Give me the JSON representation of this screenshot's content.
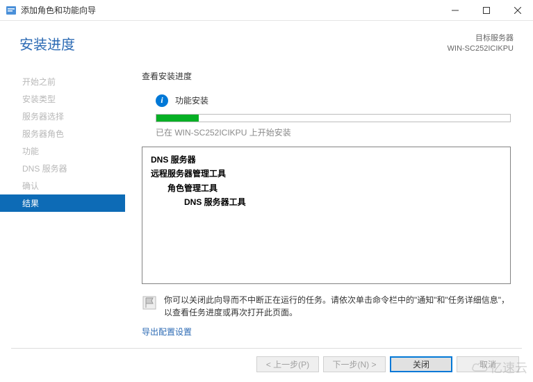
{
  "window": {
    "title": "添加角色和功能向导"
  },
  "header": {
    "title": "安装进度",
    "target_label": "目标服务器",
    "target_value": "WIN-SC252ICIKPU"
  },
  "sidebar": {
    "items": [
      {
        "label": "开始之前",
        "active": false
      },
      {
        "label": "安装类型",
        "active": false
      },
      {
        "label": "服务器选择",
        "active": false
      },
      {
        "label": "服务器角色",
        "active": false
      },
      {
        "label": "功能",
        "active": false
      },
      {
        "label": "DNS 服务器",
        "active": false
      },
      {
        "label": "确认",
        "active": false
      },
      {
        "label": "结果",
        "active": true
      }
    ]
  },
  "main": {
    "section_label": "查看安装进度",
    "status_text": "功能安装",
    "progress_label": "已在 WIN-SC252ICIKPU 上开始安装",
    "install_tree": [
      {
        "label": "DNS 服务器",
        "bold": true,
        "indent": 0
      },
      {
        "label": "远程服务器管理工具",
        "bold": true,
        "indent": 0
      },
      {
        "label": "角色管理工具",
        "bold": true,
        "indent": 1
      },
      {
        "label": "DNS 服务器工具",
        "bold": true,
        "indent": 2
      }
    ],
    "hint_text": "你可以关闭此向导而不中断正在运行的任务。请依次单击命令栏中的\"通知\"和\"任务详细信息\"，以查看任务进度或再次打开此页面。",
    "export_link": "导出配置设置"
  },
  "footer": {
    "prev": "< 上一步(P)",
    "next": "下一步(N) >",
    "close": "关闭",
    "cancel": "取消"
  },
  "watermark": "亿速云"
}
